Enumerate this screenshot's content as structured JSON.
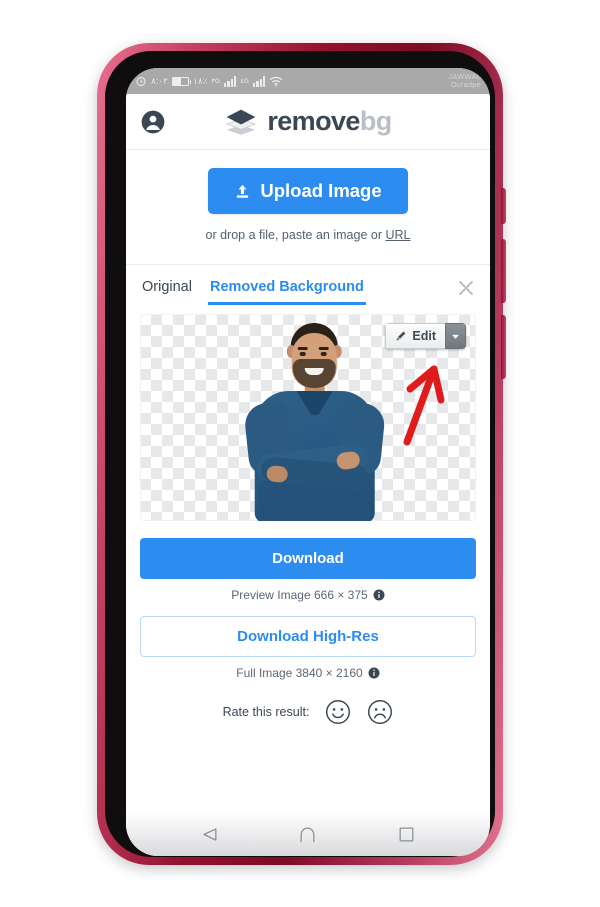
{
  "device": {
    "frame_color": "#93112f",
    "statusbar": {
      "time": "٨:٠٢",
      "signal_labels": [
        "٣G",
        "٤G"
      ],
      "battery_label": "١٨٪",
      "watermark_line1": "JAWWAL",
      "watermark_line2": "Ocradpe",
      "icons": [
        "alarm-icon",
        "battery-icon",
        "signal-bars-icon",
        "signal-bars-icon",
        "wifi-icon"
      ]
    },
    "navbar": {
      "back_label": "back-icon",
      "home_label": "home-icon",
      "recents_label": "recents-icon"
    }
  },
  "header": {
    "account_icon": "account-circle-icon",
    "logo_icon": "layers-icon",
    "brand_dark": "remove",
    "brand_grey": "bg"
  },
  "upload": {
    "button_label": "Upload Image",
    "button_icon": "upload-icon",
    "hint_prefix": "or drop a file, paste an image or ",
    "hint_link": "URL",
    "accent_color": "#2d8cf0"
  },
  "tabs": {
    "items": [
      {
        "label": "Original",
        "active": false
      },
      {
        "label": "Removed Background",
        "active": true
      }
    ],
    "close_icon": "close-icon"
  },
  "preview": {
    "background": "transparency-checkerboard",
    "subject": "man-in-blue-sweater-arms-crossed",
    "edit_button": {
      "label": "Edit",
      "icon": "brush-icon",
      "caret_icon": "chevron-down-icon"
    },
    "annotation": {
      "type": "red-arrow",
      "color": "#e01b1b",
      "points_to": "edit-button"
    }
  },
  "download": {
    "primary_label": "Download",
    "preview_meta": "Preview Image 666 × 375",
    "preview_info_icon": "info-icon",
    "highres_label": "Download High-Res",
    "full_meta": "Full Image 3840 × 2160",
    "full_info_icon": "info-icon"
  },
  "rate": {
    "label": "Rate this result:",
    "positive_icon": "smiley-happy-icon",
    "negative_icon": "smiley-sad-icon"
  }
}
